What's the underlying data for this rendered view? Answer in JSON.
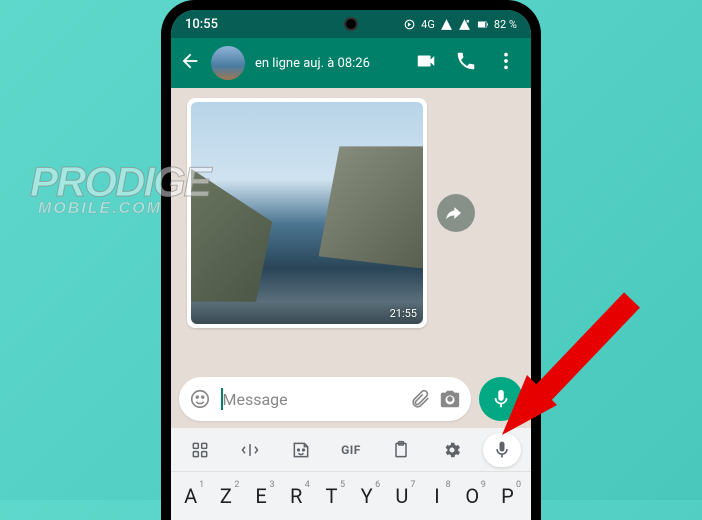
{
  "statusbar": {
    "time": "10:55",
    "network_label": "4G",
    "battery_text": "82 %"
  },
  "chat_header": {
    "status_text": "en ligne auj. à 08:26"
  },
  "message": {
    "time": "21:55"
  },
  "input": {
    "placeholder": "Message"
  },
  "keyboard": {
    "toolbar": {
      "gif_label": "GIF"
    },
    "row1": [
      {
        "key": "A",
        "sup": "1"
      },
      {
        "key": "Z",
        "sup": "2"
      },
      {
        "key": "E",
        "sup": "3"
      },
      {
        "key": "R",
        "sup": "4"
      },
      {
        "key": "T",
        "sup": "5"
      },
      {
        "key": "Y",
        "sup": "6"
      },
      {
        "key": "U",
        "sup": "7"
      },
      {
        "key": "I",
        "sup": "8"
      },
      {
        "key": "O",
        "sup": "9"
      },
      {
        "key": "P",
        "sup": "0"
      }
    ]
  },
  "watermark": {
    "line1": "PRODIGE",
    "line2": "MOBILE.COM"
  }
}
